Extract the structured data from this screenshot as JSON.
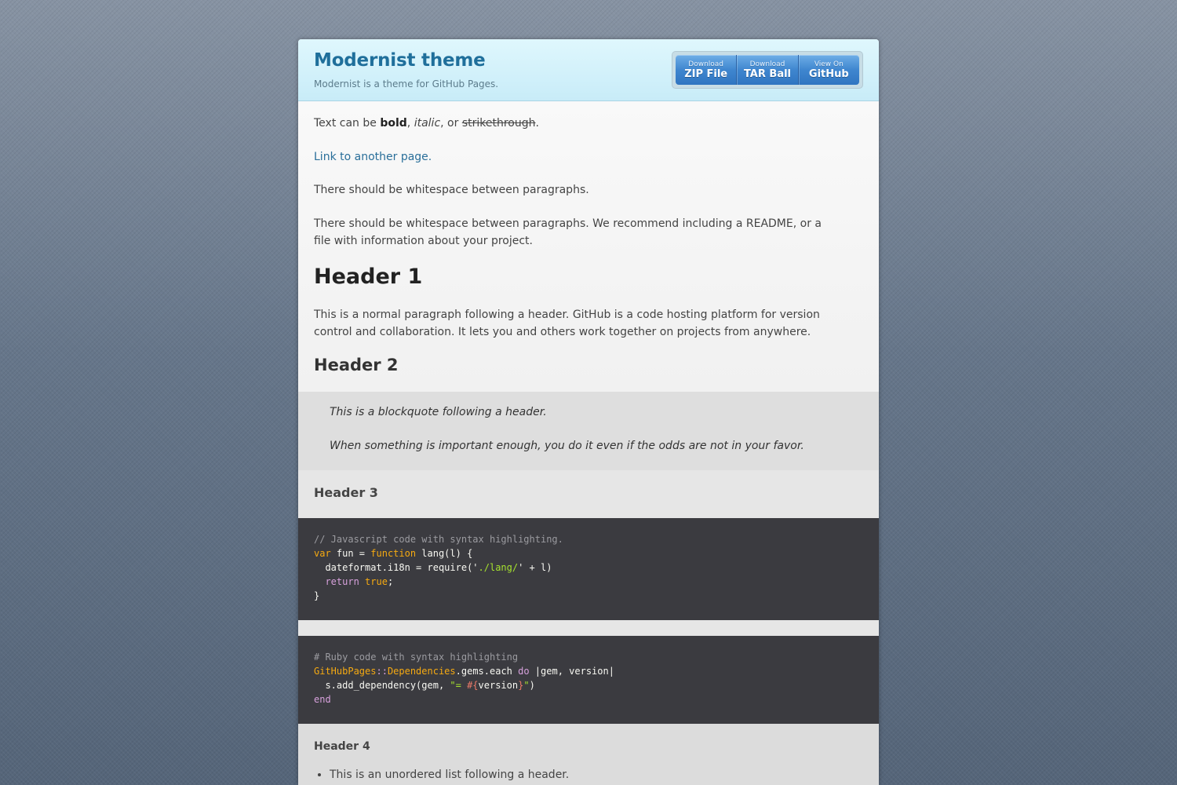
{
  "header": {
    "title": "Modernist theme",
    "tagline": "Modernist is a theme for GitHub Pages."
  },
  "downloads": [
    {
      "small": "Download",
      "big": "ZIP File"
    },
    {
      "small": "Download",
      "big": "TAR Ball"
    },
    {
      "small": "View On",
      "big": "GitHub"
    }
  ],
  "content": {
    "p1": {
      "prefix": "Text can be ",
      "bold": "bold",
      "comma": ", ",
      "italic": "italic",
      "or": ", or ",
      "strike": "strikethrough",
      "end": "."
    },
    "link": "Link to another page.",
    "p2": "There should be whitespace between paragraphs.",
    "p3": "There should be whitespace between paragraphs. We recommend including a README, or a file with information about your project.",
    "h1": "Header 1",
    "p4": "This is a normal paragraph following a header. GitHub is a code hosting platform for version control and collaboration. It lets you and others work together on projects from anywhere.",
    "h2": "Header 2",
    "quote1": "This is a blockquote following a header.",
    "quote2": "When something is important enough, you do it even if the odds are not in your favor.",
    "h3": "Header 3",
    "h4": "Header 4",
    "list_item_1": "This is an unordered list following a header."
  },
  "code_js": {
    "comment": "// Javascript code with syntax highlighting.",
    "var": "var",
    "fun_decl": " fun = ",
    "function": "function",
    "lang_open": " lang(l) {",
    "line3_a": "  dateformat.i18n = require('",
    "line3_str": "./lang/",
    "line3_b": "' + l)",
    "indent": "  ",
    "return": "return",
    "space": " ",
    "true": "true",
    "semi": ";",
    "close": "}"
  },
  "code_rb": {
    "comment": "# Ruby code with syntax highlighting",
    "const1": "GitHubPages",
    "sep": "::",
    "const2": "Dependencies",
    "gems": ".gems.each ",
    "do": "do",
    "params": " |gem, version|",
    "line3_a": "  s.add_dependency(gem, ",
    "line3_str": "\"= ",
    "interp_open": "#{",
    "interp_var": "version",
    "interp_close": "}",
    "line3_strend": "\"",
    "line3_b": ")",
    "end": "end"
  }
}
